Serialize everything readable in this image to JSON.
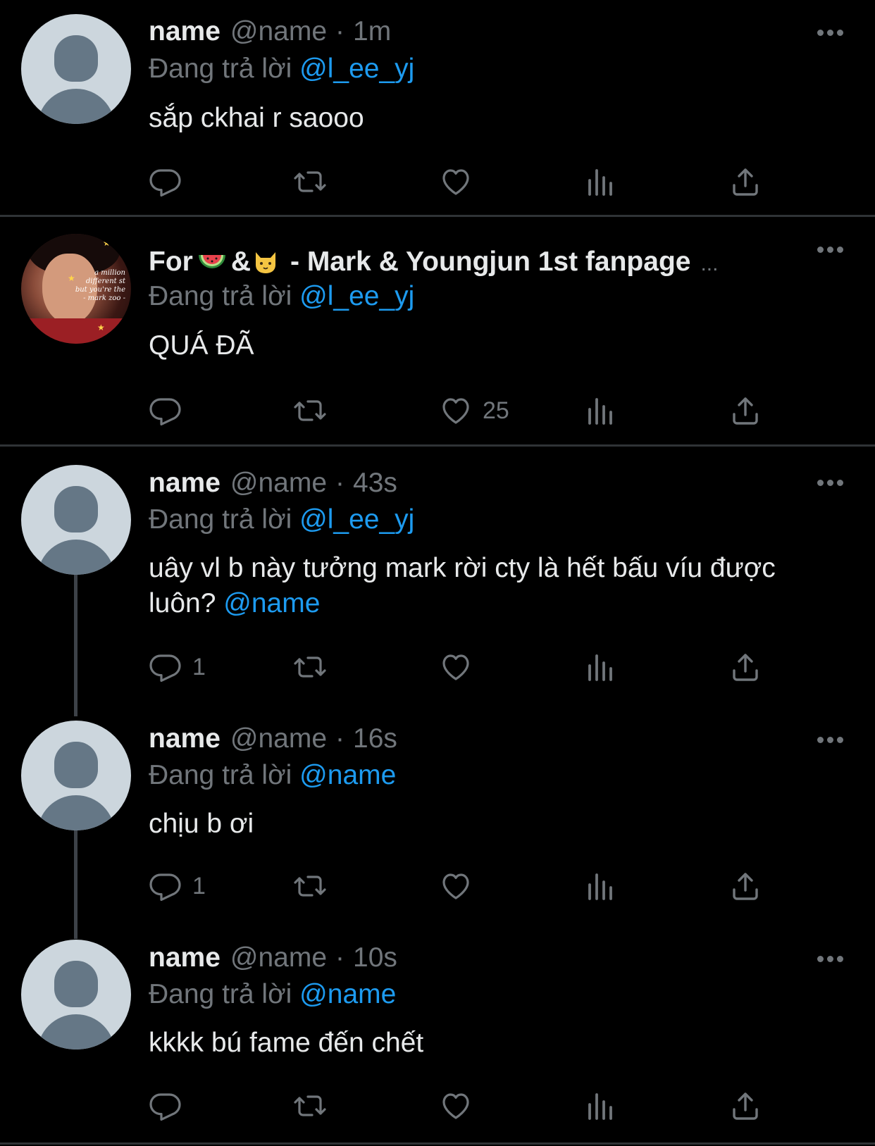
{
  "reply_prefix": "Đang trả lời",
  "tweets": [
    {
      "name": "name",
      "handle": "@name",
      "dot": "·",
      "time": "1m",
      "reply_to": "@l_ee_yj",
      "text": "sắp ckhai r saooo",
      "text_mention": "",
      "counts": {
        "reply": "",
        "retweet": "",
        "like": ""
      }
    },
    {
      "name_prefix": "For",
      "name_amp": "&",
      "name_suffix": "- Mark & Youngjun 1st fanpage",
      "name_ellipsis": "...",
      "avatar_caption": "a million\ndifferent st\nbut you're the\n- mark zoo -",
      "reply_to": "@l_ee_yj",
      "text": "QUÁ ĐÃ",
      "text_mention": "",
      "counts": {
        "reply": "",
        "retweet": "",
        "like": "25"
      }
    },
    {
      "name": "name",
      "handle": "@name",
      "dot": "·",
      "time": "43s",
      "reply_to": "@l_ee_yj",
      "text": "uây vl b này tưởng mark rời cty là hết bấu víu được luôn?",
      "text_mention": "@name",
      "counts": {
        "reply": "1",
        "retweet": "",
        "like": ""
      }
    },
    {
      "name": "name",
      "handle": "@name",
      "dot": "·",
      "time": "16s",
      "reply_to": "@name",
      "text": "chịu b ơi",
      "text_mention": "",
      "counts": {
        "reply": "1",
        "retweet": "",
        "like": ""
      }
    },
    {
      "name": "name",
      "handle": "@name",
      "dot": "·",
      "time": "10s",
      "reply_to": "@name",
      "text": "kkkk bú fame đến chết",
      "text_mention": "",
      "counts": {
        "reply": "",
        "retweet": "",
        "like": ""
      }
    }
  ],
  "icons": {
    "reply": "reply-icon",
    "retweet": "retweet-icon",
    "like": "heart-icon",
    "views": "views-icon",
    "share": "share-icon",
    "more": "more-icon"
  },
  "colors": {
    "background": "#000000",
    "text": "#e7e9ea",
    "secondary": "#71767b",
    "mention": "#1d9bf0",
    "divider": "#2f3336",
    "avatar_bg": "#ccd6dd",
    "avatar_fg": "#657786"
  }
}
